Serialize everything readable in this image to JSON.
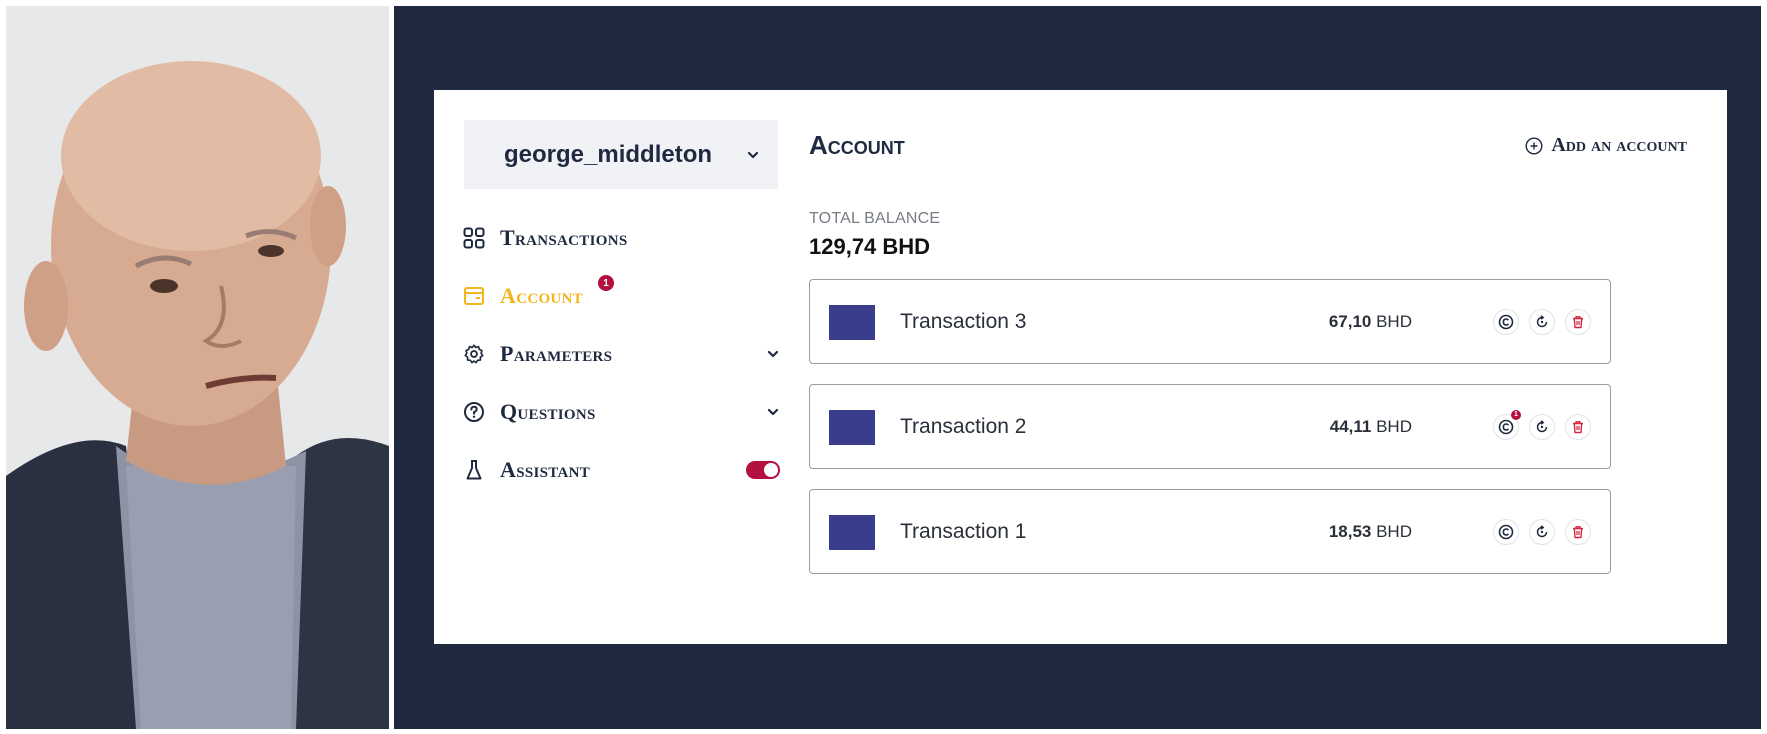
{
  "photo": {
    "alt": "Portrait photo"
  },
  "user": {
    "name": "george_middleton",
    "dropdown_icon": "chevron-down-icon"
  },
  "nav": {
    "items": [
      {
        "label": "Transactions",
        "icon": "grid-icon",
        "active": false
      },
      {
        "label": "Account",
        "icon": "wallet-icon",
        "active": true,
        "badge": "1"
      },
      {
        "label": "Parameters",
        "icon": "gear-icon",
        "active": false,
        "expandable": true
      },
      {
        "label": "Questions",
        "icon": "help-circle-icon",
        "active": false,
        "expandable": true
      },
      {
        "label": "Assistant",
        "icon": "flask-icon",
        "active": false,
        "toggle": true
      }
    ]
  },
  "main": {
    "title": "Account",
    "add_account_label": "Add an account",
    "balance_label": "TOTAL BALANCE",
    "balance_value": "129,74 BHD"
  },
  "transactions": [
    {
      "name": "Transaction 3",
      "amount": "67,10",
      "currency": "BHD",
      "badge": ""
    },
    {
      "name": "Transaction 2",
      "amount": "44,11",
      "currency": "BHD",
      "badge": "1"
    },
    {
      "name": "Transaction 1",
      "amount": "18,53",
      "currency": "BHD",
      "badge": ""
    }
  ],
  "colors": {
    "frame": "#1f2a40",
    "accent": "#f3b51c",
    "danger": "#b3103f",
    "swatch": "#3a3c8c",
    "text": "#1f2a40"
  }
}
